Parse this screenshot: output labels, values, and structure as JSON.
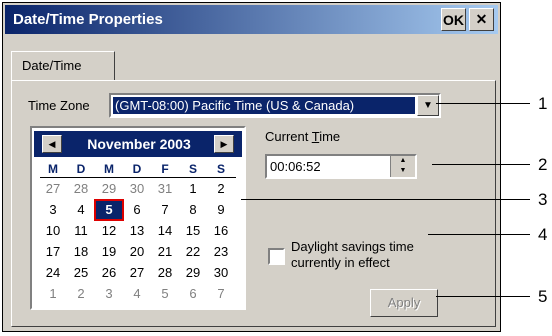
{
  "window": {
    "title": "Date/Time Properties",
    "ok_label": "OK",
    "close_label": "✕"
  },
  "tab": {
    "label": "Date/Time"
  },
  "timezone": {
    "label": "Time Zone",
    "value": "(GMT-08:00) Pacific Time (US & Canada)"
  },
  "calendar": {
    "month_label": "November 2003",
    "weekdays": [
      "M",
      "D",
      "M",
      "D",
      "F",
      "S",
      "S"
    ],
    "weeks": [
      [
        {
          "d": "27",
          "o": 1
        },
        {
          "d": "28",
          "o": 1
        },
        {
          "d": "29",
          "o": 1
        },
        {
          "d": "30",
          "o": 1
        },
        {
          "d": "31",
          "o": 1
        },
        {
          "d": "1"
        },
        {
          "d": "2"
        }
      ],
      [
        {
          "d": "3"
        },
        {
          "d": "4"
        },
        {
          "d": "5",
          "sel": 1
        },
        {
          "d": "6"
        },
        {
          "d": "7"
        },
        {
          "d": "8"
        },
        {
          "d": "9"
        }
      ],
      [
        {
          "d": "10"
        },
        {
          "d": "11"
        },
        {
          "d": "12"
        },
        {
          "d": "13"
        },
        {
          "d": "14"
        },
        {
          "d": "15"
        },
        {
          "d": "16"
        }
      ],
      [
        {
          "d": "17"
        },
        {
          "d": "18"
        },
        {
          "d": "19"
        },
        {
          "d": "20"
        },
        {
          "d": "21"
        },
        {
          "d": "22"
        },
        {
          "d": "23"
        }
      ],
      [
        {
          "d": "24"
        },
        {
          "d": "25"
        },
        {
          "d": "26"
        },
        {
          "d": "27"
        },
        {
          "d": "28"
        },
        {
          "d": "29"
        },
        {
          "d": "30"
        }
      ],
      [
        {
          "d": "1",
          "o": 1
        },
        {
          "d": "2",
          "o": 1
        },
        {
          "d": "3",
          "o": 1
        },
        {
          "d": "4",
          "o": 1
        },
        {
          "d": "5",
          "o": 1
        },
        {
          "d": "6",
          "o": 1
        },
        {
          "d": "7",
          "o": 1
        }
      ]
    ]
  },
  "current_time": {
    "label": "Current Time",
    "value": "00:06:52"
  },
  "daylight": {
    "label_line1": "Daylight savings time",
    "label_line2": "currently in effect"
  },
  "apply_label": "Apply",
  "callouts": [
    "1",
    "2",
    "3",
    "4",
    "5"
  ]
}
